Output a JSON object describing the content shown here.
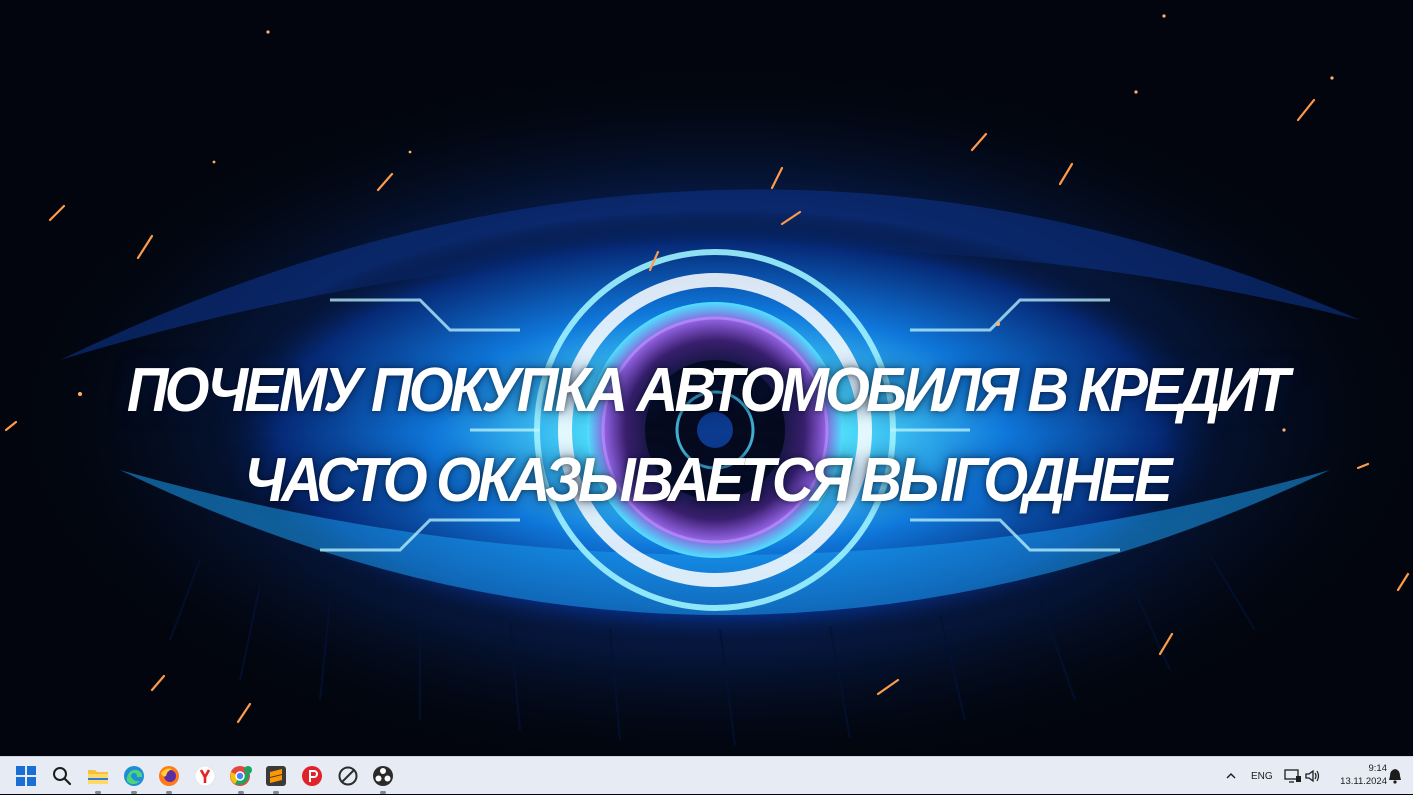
{
  "wallpaper": {
    "headline_line_1": "ПОЧЕМУ ПОКУПКА АВТОМОБИЛЯ В КРЕДИТ",
    "headline_line_2": "ЧАСТО ОКАЗЫВАЕТСЯ ВЫГОДНЕЕ",
    "colors": {
      "glow": "#2fd2ff",
      "deep": "#0a3fb0",
      "spark": "#ff9a4a",
      "background": "#02050d"
    }
  },
  "taskbar": {
    "pinned_icons": [
      "windows-start-icon",
      "search-icon",
      "file-explorer-icon",
      "edge-icon",
      "firefox-icon",
      "yandex-browser-icon",
      "chrome-canary-icon",
      "sublime-text-icon",
      "red-p-app-icon",
      "blocked-circle-app-icon",
      "obs-icon"
    ],
    "tray": {
      "language": "ENG",
      "time": "9:14",
      "date": "13.11.2024"
    },
    "colors": {
      "background": "#e6ebf4",
      "windows_blue": "#1a6fd6"
    }
  }
}
